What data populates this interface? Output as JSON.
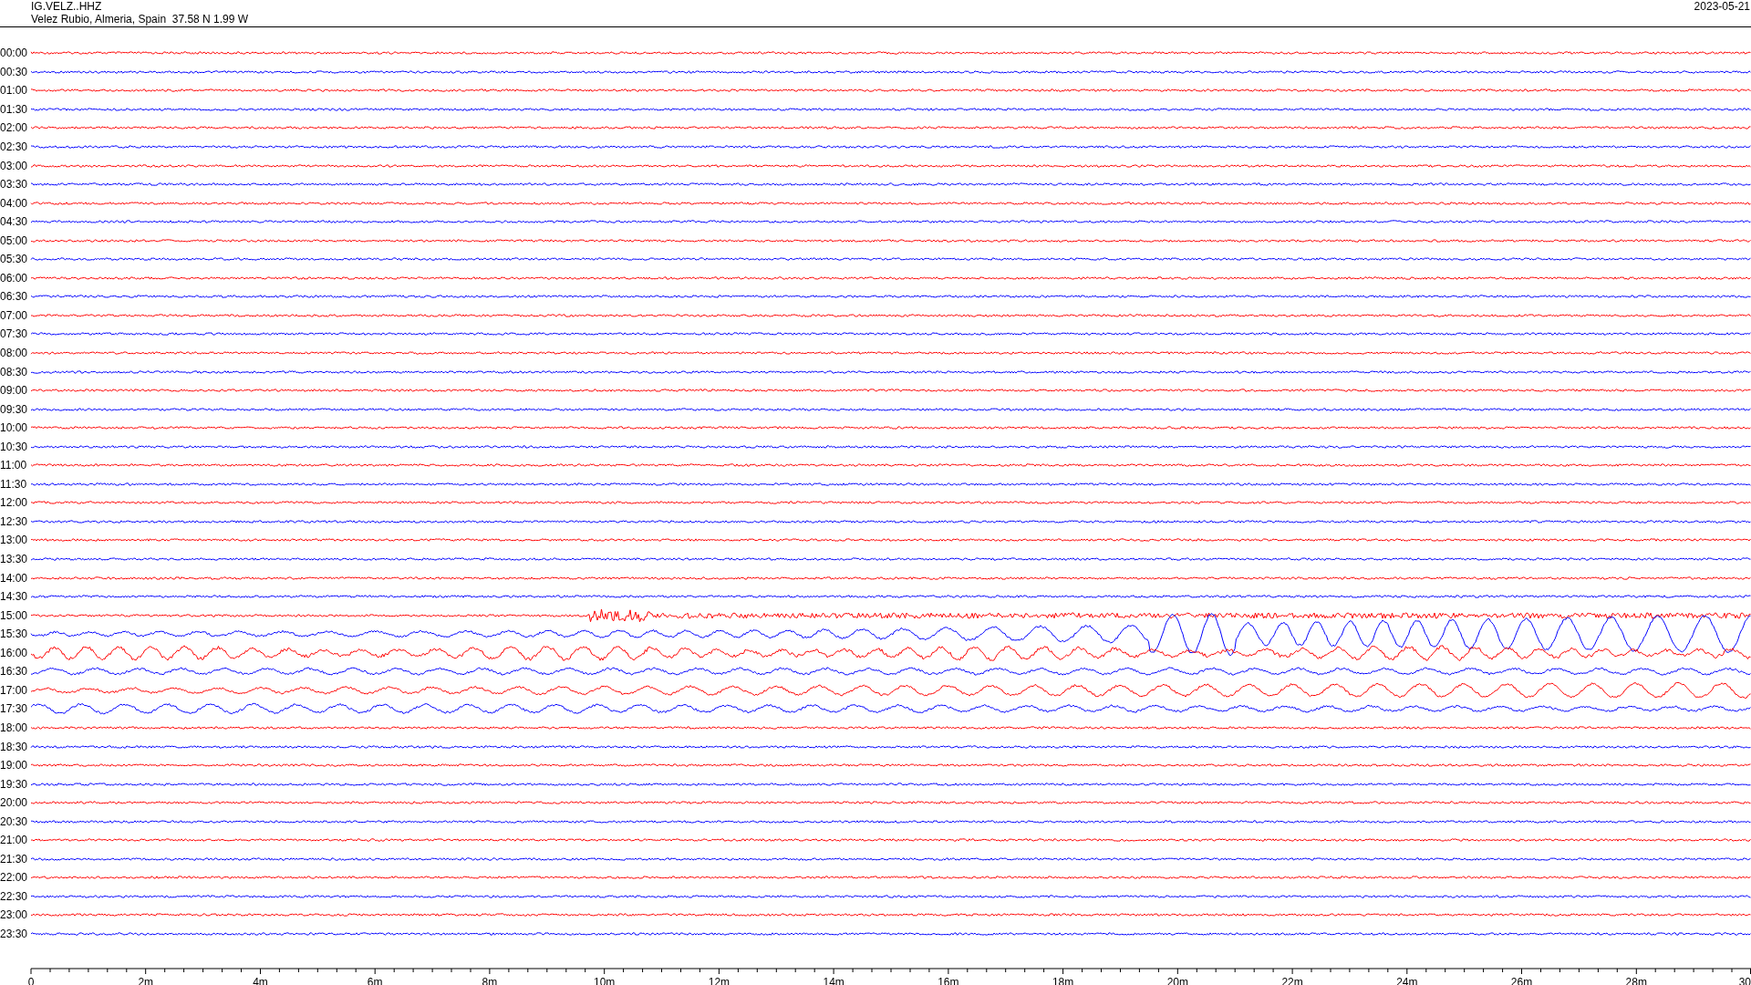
{
  "header": {
    "station": "IG.VELZ..HHZ",
    "location": "Velez Rubio, Almeria, Spain  37.58 N 1.99 W",
    "date": "2023-05-21"
  },
  "rows": [
    {
      "time": "00:00",
      "color": "#ff0000",
      "kind": "noise"
    },
    {
      "time": "00:30",
      "color": "#0000ff",
      "kind": "noise"
    },
    {
      "time": "01:00",
      "color": "#ff0000",
      "kind": "noise"
    },
    {
      "time": "01:30",
      "color": "#0000ff",
      "kind": "noise"
    },
    {
      "time": "02:00",
      "color": "#ff0000",
      "kind": "noise"
    },
    {
      "time": "02:30",
      "color": "#0000ff",
      "kind": "noise"
    },
    {
      "time": "03:00",
      "color": "#ff0000",
      "kind": "noise"
    },
    {
      "time": "03:30",
      "color": "#0000ff",
      "kind": "noise"
    },
    {
      "time": "04:00",
      "color": "#ff0000",
      "kind": "noise"
    },
    {
      "time": "04:30",
      "color": "#0000ff",
      "kind": "noise"
    },
    {
      "time": "05:00",
      "color": "#ff0000",
      "kind": "noise"
    },
    {
      "time": "05:30",
      "color": "#0000ff",
      "kind": "noise"
    },
    {
      "time": "06:00",
      "color": "#ff0000",
      "kind": "noise"
    },
    {
      "time": "06:30",
      "color": "#0000ff",
      "kind": "noise"
    },
    {
      "time": "07:00",
      "color": "#ff0000",
      "kind": "noise"
    },
    {
      "time": "07:30",
      "color": "#0000ff",
      "kind": "noise"
    },
    {
      "time": "08:00",
      "color": "#ff0000",
      "kind": "noise"
    },
    {
      "time": "08:30",
      "color": "#0000ff",
      "kind": "noise"
    },
    {
      "time": "09:00",
      "color": "#ff0000",
      "kind": "noise"
    },
    {
      "time": "09:30",
      "color": "#0000ff",
      "kind": "noise"
    },
    {
      "time": "10:00",
      "color": "#ff0000",
      "kind": "noise"
    },
    {
      "time": "10:30",
      "color": "#0000ff",
      "kind": "noise"
    },
    {
      "time": "11:00",
      "color": "#ff0000",
      "kind": "noise"
    },
    {
      "time": "11:30",
      "color": "#0000ff",
      "kind": "noise"
    },
    {
      "time": "12:00",
      "color": "#ff0000",
      "kind": "noise"
    },
    {
      "time": "12:30",
      "color": "#0000ff",
      "kind": "noise"
    },
    {
      "time": "13:00",
      "color": "#ff0000",
      "kind": "noise"
    },
    {
      "time": "13:30",
      "color": "#0000ff",
      "kind": "noise"
    },
    {
      "time": "14:00",
      "color": "#ff0000",
      "kind": "noise"
    },
    {
      "time": "14:30",
      "color": "#0000ff",
      "kind": "noise"
    },
    {
      "time": "15:00",
      "color": "#ff0000",
      "kind": "onset"
    },
    {
      "time": "15:30",
      "color": "#0000ff",
      "kind": "growing"
    },
    {
      "time": "16:00",
      "color": "#ff0000",
      "kind": "swell"
    },
    {
      "time": "16:30",
      "color": "#0000ff",
      "kind": "moderate"
    },
    {
      "time": "17:00",
      "color": "#ff0000",
      "kind": "moderate"
    },
    {
      "time": "17:30",
      "color": "#0000ff",
      "kind": "moderate"
    },
    {
      "time": "18:00",
      "color": "#ff0000",
      "kind": "noise"
    },
    {
      "time": "18:30",
      "color": "#0000ff",
      "kind": "noise"
    },
    {
      "time": "19:00",
      "color": "#ff0000",
      "kind": "noise"
    },
    {
      "time": "19:30",
      "color": "#0000ff",
      "kind": "noise"
    },
    {
      "time": "20:00",
      "color": "#ff0000",
      "kind": "noise"
    },
    {
      "time": "20:30",
      "color": "#0000ff",
      "kind": "noise"
    },
    {
      "time": "21:00",
      "color": "#ff0000",
      "kind": "noise"
    },
    {
      "time": "21:30",
      "color": "#0000ff",
      "kind": "noise"
    },
    {
      "time": "22:00",
      "color": "#ff0000",
      "kind": "noise"
    },
    {
      "time": "22:30",
      "color": "#0000ff",
      "kind": "noise"
    },
    {
      "time": "23:00",
      "color": "#ff0000",
      "kind": "noise"
    },
    {
      "time": "23:30",
      "color": "#0000ff",
      "kind": "noise"
    }
  ],
  "x_axis": {
    "ticks": [
      "0",
      "2m",
      "4m",
      "6m",
      "8m",
      "10m",
      "12m",
      "14m",
      "16m",
      "18m",
      "20m",
      "22m",
      "24m",
      "26m",
      "28m",
      "30"
    ]
  }
}
